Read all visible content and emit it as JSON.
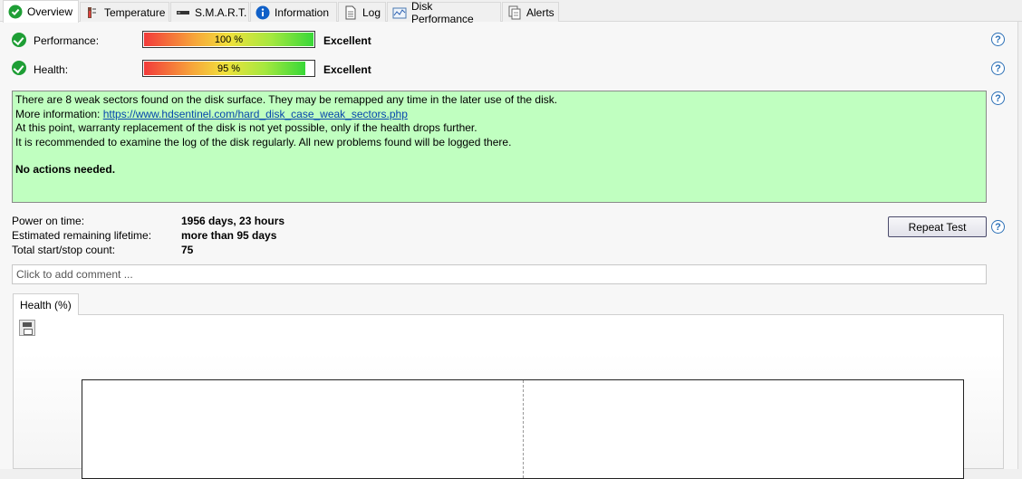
{
  "tabs": [
    {
      "label": "Overview",
      "icon": "check-circle-icon",
      "active": true
    },
    {
      "label": "Temperature",
      "icon": "thermometer-icon"
    },
    {
      "label": "S.M.A.R.T.",
      "icon": "drive-icon"
    },
    {
      "label": "Information",
      "icon": "info-icon"
    },
    {
      "label": "Log",
      "icon": "document-icon"
    },
    {
      "label": "Disk Performance",
      "icon": "chart-icon"
    },
    {
      "label": "Alerts",
      "icon": "pages-icon"
    }
  ],
  "performance": {
    "label": "Performance:",
    "percent_text": "100 %",
    "value": 100,
    "status": "Excellent"
  },
  "health": {
    "label": "Health:",
    "percent_text": "95 %",
    "value": 95,
    "status": "Excellent"
  },
  "message": {
    "line1": "There are 8 weak sectors found on the disk surface. They may be remapped any time in the later use of the disk.",
    "more_info_prefix": "More information: ",
    "link": "https://www.hdsentinel.com/hard_disk_case_weak_sectors.php",
    "line3": "At this point, warranty replacement of the disk is not yet possible, only if the health drops further.",
    "line4": "It is recommended to examine the log of the disk regularly. All new problems found will be logged there.",
    "action": "No actions needed."
  },
  "info": {
    "power_on_label": "Power on time:",
    "power_on_value": "1956 days, 23 hours",
    "lifetime_label": "Estimated remaining lifetime:",
    "lifetime_value": "more than 95 days",
    "startstop_label": "Total start/stop count:",
    "startstop_value": "75"
  },
  "repeat_button": "Repeat Test",
  "comment_placeholder": "Click to add comment ...",
  "chart_tab": "Health (%)",
  "help_symbol": "?",
  "colors": {
    "message_bg": "#c0ffc0",
    "ok_green": "#1e9e35",
    "help_blue": "#2a6fb6"
  }
}
